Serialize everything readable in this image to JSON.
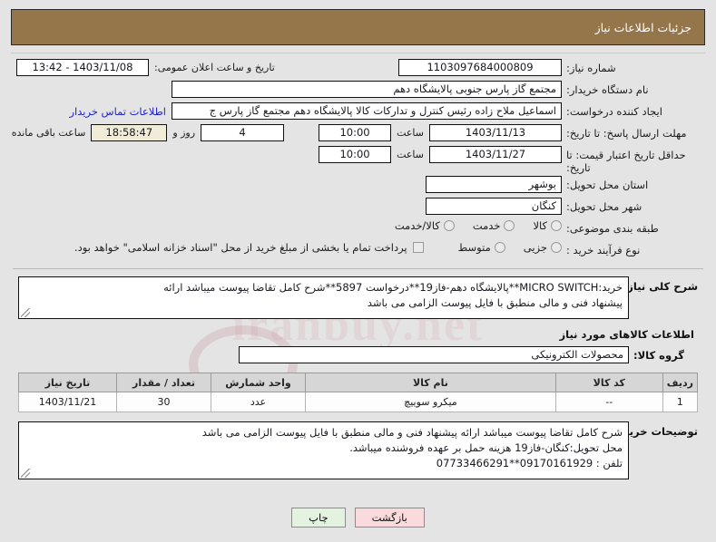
{
  "header": {
    "title": "جزئیات اطلاعات نیاز"
  },
  "watermark": {
    "text": "iranbuy.net"
  },
  "form": {
    "need_number": {
      "label": "شماره نیاز:",
      "value": "1103097684000809"
    },
    "announce_datetime": {
      "label": "تاریخ و ساعت اعلان عمومی:",
      "value": "1403/11/08 - 13:42"
    },
    "buyer_org": {
      "label": "نام دستگاه خریدار:",
      "value": "مجتمع گاز پارس جنوبی  پالایشگاه دهم"
    },
    "requester": {
      "label": "ایجاد کننده درخواست:",
      "value": "اسماعیل ملاح زاده رئیس کنترل و تدارکات کالا پالایشگاه دهم مجتمع گاز پارس ج",
      "contact_link": "اطلاعات تماس خریدار"
    },
    "response_deadline": {
      "label": "مهلت ارسال پاسخ: تا تاریخ:",
      "date": "1403/11/13",
      "time_label": "ساعت",
      "time": "10:00",
      "days_remaining": "4",
      "days_label": "روز و",
      "clock_remaining": "18:58:47",
      "remaining_label": "ساعت باقی مانده"
    },
    "price_validity": {
      "label": "حداقل تاریخ اعتبار قیمت: تا تاریخ:",
      "date": "1403/11/27",
      "time_label": "ساعت",
      "time": "10:00"
    },
    "province": {
      "label": "استان محل تحویل:",
      "value": "بوشهر"
    },
    "city": {
      "label": "شهر محل تحویل:",
      "value": "کنگان"
    },
    "subject_class": {
      "label": "طبقه بندی موضوعی:",
      "options": [
        "کالا",
        "خدمت",
        "کالا/خدمت"
      ],
      "selected": ""
    },
    "purchase_process": {
      "label": "نوع فرآیند خرید :",
      "options": [
        "جزیی",
        "متوسط"
      ],
      "selected": "",
      "treasury_note": "پرداخت تمام یا بخشی از مبلغ خرید از محل \"اسناد خزانه اسلامی\" خواهد بود.",
      "treasury_checked": false
    }
  },
  "need_description": {
    "label": "شرح کلی نیاز:",
    "lines": [
      "خرید:MICRO SWITCH**پالایشگاه دهم-فاز19**درخواست 5897**شرح کامل تقاضا پیوست میباشد ارائه",
      "پیشنهاد فنی و مالی منطبق با فایل پیوست الزامی می باشد"
    ]
  },
  "items_section": {
    "title": "اطلاعات کالاهای مورد نیاز",
    "group_label": "گروه کالا:",
    "group_value": "محصولات الکترونیکی",
    "columns": [
      "ردیف",
      "کد کالا",
      "نام کالا",
      "واحد شمارش",
      "تعداد / مقدار",
      "تاریخ نیاز"
    ],
    "rows": [
      {
        "row": "1",
        "code": "--",
        "name": "میکرو سوییچ",
        "unit": "عدد",
        "qty": "30",
        "date": "1403/11/21"
      }
    ]
  },
  "buyer_notes": {
    "label": "توضیحات خریدار:",
    "lines": [
      "شرح کامل تقاضا پیوست میباشد ارائه پیشنهاد فنی و مالی منطبق با فایل پیوست الزامی می باشد",
      "محل تحویل:کنگان-فاز19 هزینه حمل بر عهده فروشنده میباشد.",
      "تلفن : 09170161929**07733466291"
    ]
  },
  "footer": {
    "print_label": "چاپ",
    "back_label": "بازگشت"
  }
}
